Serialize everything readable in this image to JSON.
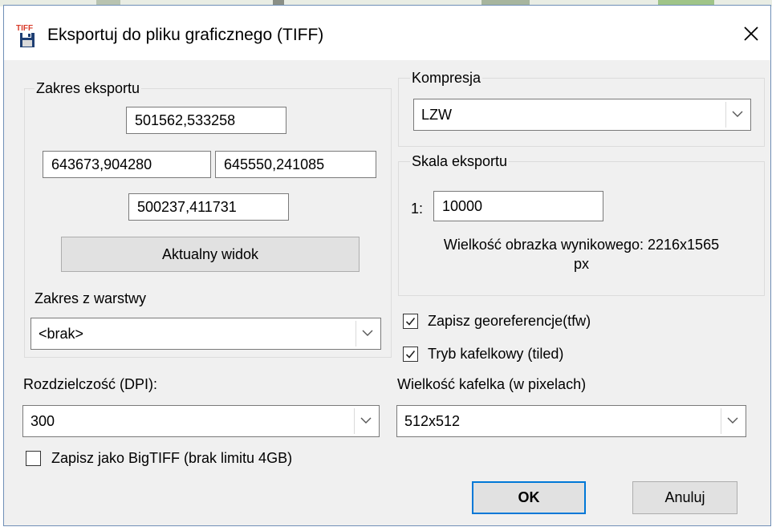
{
  "window": {
    "title": "Eksportuj do pliku graficznego (TIFF)",
    "icon": "tiff-file-save-icon",
    "icon_text": "TIFF",
    "close_label": "✕"
  },
  "export_range": {
    "group_title": "Zakres eksportu",
    "top": "501562,533258",
    "left": "643673,904280",
    "right": "645550,241085",
    "bottom": "500237,411731",
    "current_view_button": "Aktualny widok",
    "from_layer_label": "Zakres z warstwy",
    "from_layer_value": "<brak>"
  },
  "compression": {
    "group_title": "Kompresja",
    "value": "LZW"
  },
  "scale": {
    "group_title": "Skala eksportu",
    "prefix": "1:",
    "value": "10000",
    "result_text_line1": "Wielkość obrazka wynikowego: 2216x1565",
    "result_text_line2": "px"
  },
  "resolution": {
    "label": "Rozdzielczość (DPI):",
    "value": "300"
  },
  "bigtiff": {
    "label": "Zapisz jako BigTIFF (brak limitu 4GB)",
    "checked": false
  },
  "georef": {
    "label": "Zapisz georeferencje(tfw)",
    "checked": true
  },
  "tiled": {
    "label": "Tryb kafelkowy (tiled)",
    "checked": true
  },
  "tile_size": {
    "label": "Wielkość kafelka (w pixelach)",
    "value": "512x512"
  },
  "buttons": {
    "ok": "OK",
    "cancel": "Anuluj"
  },
  "colors": {
    "accent": "#0078d7",
    "dialog_bg": "#f0f0f0",
    "icon_red": "#d83b2a"
  }
}
